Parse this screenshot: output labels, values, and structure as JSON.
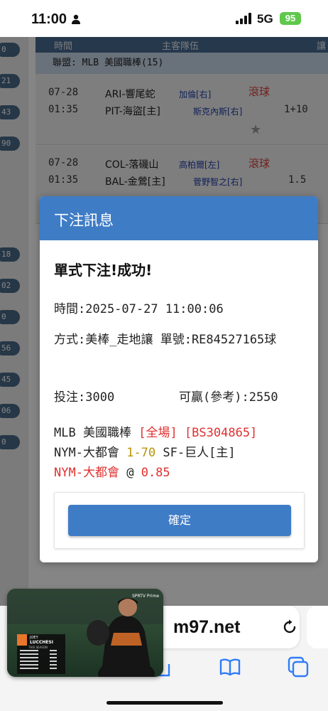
{
  "status_bar": {
    "time": "11:00",
    "network": "5G",
    "battery": "95"
  },
  "background": {
    "table_header": {
      "time": "時間",
      "teams": "主客隊伍",
      "handicap": "讓"
    },
    "league_label": "聯盟: MLB 美國職棒(15)",
    "side_counts": [
      "0",
      "21",
      "43",
      "90",
      "18",
      "02",
      "0",
      "56",
      "45",
      "06",
      "0"
    ],
    "matches": [
      {
        "date": "07-28",
        "time": "01:35",
        "away": "ARI-響尾蛇",
        "away_pitcher": "加倫[右]",
        "home": "PIT-海盜[主]",
        "home_pitcher": "斯克內斯[右]",
        "status": "滾球",
        "line": "1+10"
      },
      {
        "date": "07-28",
        "time": "01:35",
        "away": "COL-落磯山",
        "away_pitcher": "高柏爾[左]",
        "home": "BAL-金鶯[主]",
        "home_pitcher": "菅野智之[右]",
        "status": "滾球",
        "line": "1.5"
      }
    ]
  },
  "modal": {
    "title": "下注訊息",
    "headline": "單式下注!成功!",
    "time_line": "時間:2025-07-27 11:00:06",
    "method_line": "方式:美棒_走地讓 單號:RE84527165球",
    "stake_line": "投注:3000",
    "win_line": "可贏(參考):2550",
    "league": "MLB 美國職棒",
    "period": "[全場]",
    "bet_code": "[BS304865]",
    "team_away": "NYM-大都會",
    "handicap": "1-70",
    "team_home": "SF-巨人[主]",
    "selection": "NYM-大都會",
    "at": "@",
    "odds": "0.85",
    "confirm_label": "確定"
  },
  "browser": {
    "url": "m97.net"
  },
  "pip": {
    "player_first": "JOEY",
    "player_last": "LUCCHESI",
    "label": "THIS SEASON",
    "network": "SPRTV Prime"
  }
}
